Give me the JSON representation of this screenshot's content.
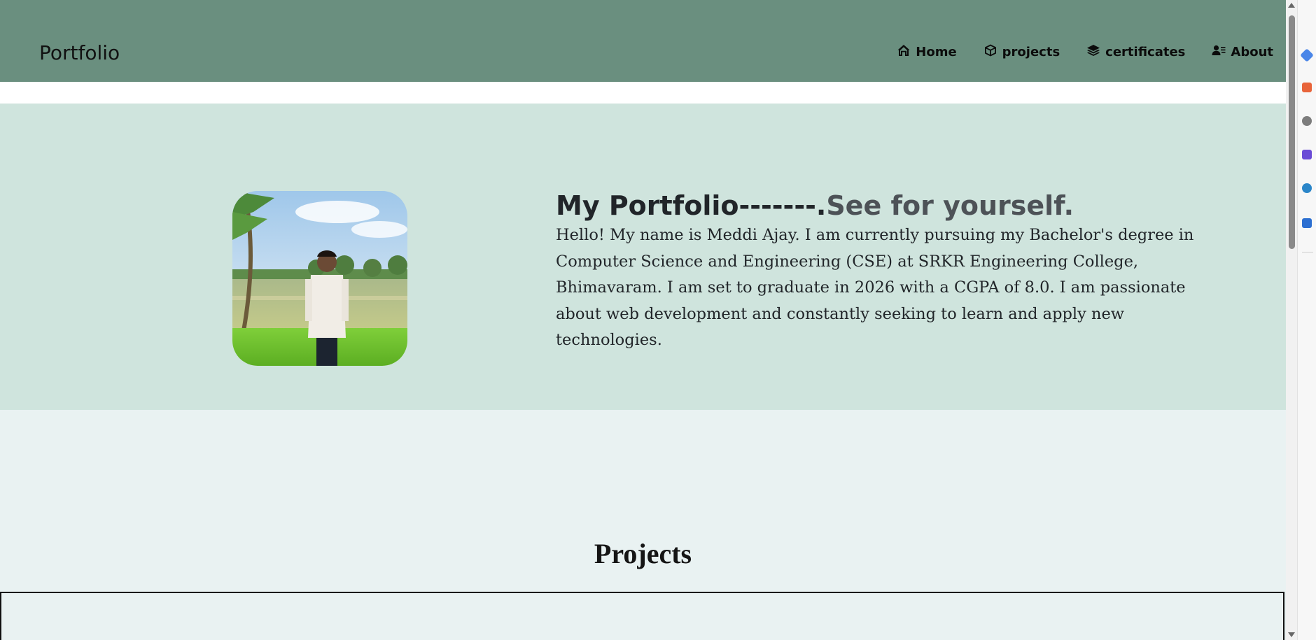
{
  "navbar": {
    "brand": "Portfolio",
    "links": [
      {
        "label": "Home",
        "icon": "home-icon"
      },
      {
        "label": "projects",
        "icon": "cube-icon"
      },
      {
        "label": "certificates",
        "icon": "layers-icon"
      },
      {
        "label": "About",
        "icon": "user-list-icon"
      }
    ]
  },
  "hero": {
    "title_main": "My Portfolio-------.",
    "title_muted": "See for yourself.",
    "bio": "Hello! My name is Meddi Ajay. I am currently pursuing my Bachelor's degree in Computer Science and Engineering (CSE) at SRKR Engineering College, Bhimavaram. I am set to graduate in 2026 with a CGPA of 8.0. I am passionate about web development and constantly seeking to learn and apply new technologies."
  },
  "projects": {
    "heading": "Projects"
  },
  "colors": {
    "navbar_bg": "#6a8f7f",
    "hero_bg": "#cfe4dd",
    "projects_bg": "#e9f2f2"
  }
}
